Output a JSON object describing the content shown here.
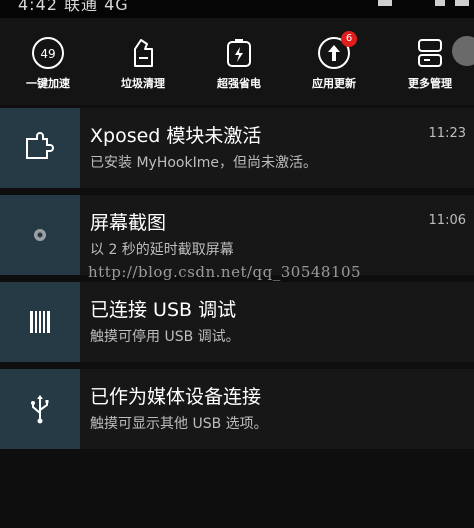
{
  "status_bar": {
    "text": "4:42 联通 4G"
  },
  "quick_settings": [
    {
      "label": "一键加速",
      "icon": "speedometer-icon",
      "value": "49"
    },
    {
      "label": "垃圾清理",
      "icon": "broom-icon"
    },
    {
      "label": "超强省电",
      "icon": "battery-icon"
    },
    {
      "label": "应用更新",
      "icon": "upload-icon",
      "badge": "6"
    },
    {
      "label": "更多管理",
      "icon": "manage-icon"
    }
  ],
  "notifications": [
    {
      "title": "Xposed 模块未激活",
      "text": "已安装 MyHookIme，但尚未激活。",
      "time": "11:23",
      "icon": "puzzle-icon"
    },
    {
      "title": "屏幕截图",
      "text": "以 2 秒的延时截取屏幕",
      "time": "11:06",
      "icon": "dot-icon"
    },
    {
      "title": "已连接 USB 调试",
      "text": "触摸可停用 USB 调试。",
      "icon": "bars-icon"
    },
    {
      "title": "已作为媒体设备连接",
      "text": "触摸可显示其他 USB 选项。",
      "icon": "usb-icon"
    }
  ],
  "watermark": "http://blog.csdn.net/qq_30548105",
  "colors": {
    "icon_bg": "#253a44",
    "badge": "#e01c1c",
    "panel": "#171717"
  }
}
